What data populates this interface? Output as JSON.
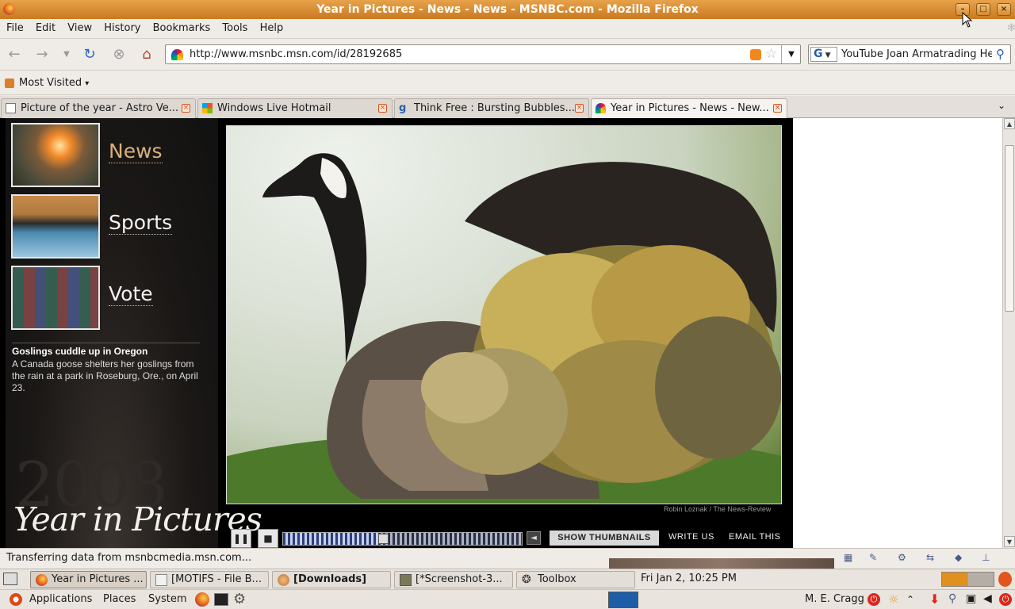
{
  "window": {
    "title": "Year in Pictures - News - News - MSNBC.com - Mozilla Firefox",
    "minimize": "–",
    "maximize": "□",
    "close": "×"
  },
  "menu": {
    "items": [
      "File",
      "Edit",
      "View",
      "History",
      "Bookmarks",
      "Tools",
      "Help"
    ]
  },
  "nav": {
    "url": "http://www.msnbc.msn.com/id/28192685",
    "search_value": "YouTube Joan Armatrading Hey",
    "search_engine": "G"
  },
  "bookmarks": {
    "most_visited": "Most Visited"
  },
  "tabs": [
    {
      "label": "Picture of the year - Astro Ve...",
      "active": false
    },
    {
      "label": "Windows Live Hotmail",
      "active": false
    },
    {
      "label": "Think Free : Bursting Bubbles...",
      "active": false
    },
    {
      "label": "Year in Pictures - News - New...",
      "active": true
    }
  ],
  "page": {
    "categories": [
      "News",
      "Sports",
      "Vote"
    ],
    "selected_category": "News",
    "caption_title": "Goslings cuddle up in Oregon",
    "caption_body": "A Canada goose shelters her goslings from the rain at a park in Roseburg, Ore., on April 23.",
    "year": "2008",
    "logo_text": "Year in Pictures",
    "credit": "Robin Loznak / The News-Review",
    "slideshow_progress": 0.4,
    "show_thumbnails": "SHOW THUMBNAILS",
    "write_us": "WRITE US",
    "email_this": "EMAIL THIS"
  },
  "status": {
    "text": "Transferring data from msnbcmedia.msn.com..."
  },
  "taskbar": {
    "items": [
      {
        "label": "Year in Pictures ...",
        "active": true
      },
      {
        "label": "[MOTIFS - File B...",
        "active": false
      },
      {
        "label": "[Downloads]",
        "active": false
      },
      {
        "label": "[*Screenshot-3...",
        "active": false
      },
      {
        "label": "Toolbox",
        "active": false
      }
    ],
    "clock": "Fri Jan  2, 10:25 PM"
  },
  "panel": {
    "applications": "Applications",
    "places": "Places",
    "system": "System",
    "user": "M. E. Cragg"
  }
}
